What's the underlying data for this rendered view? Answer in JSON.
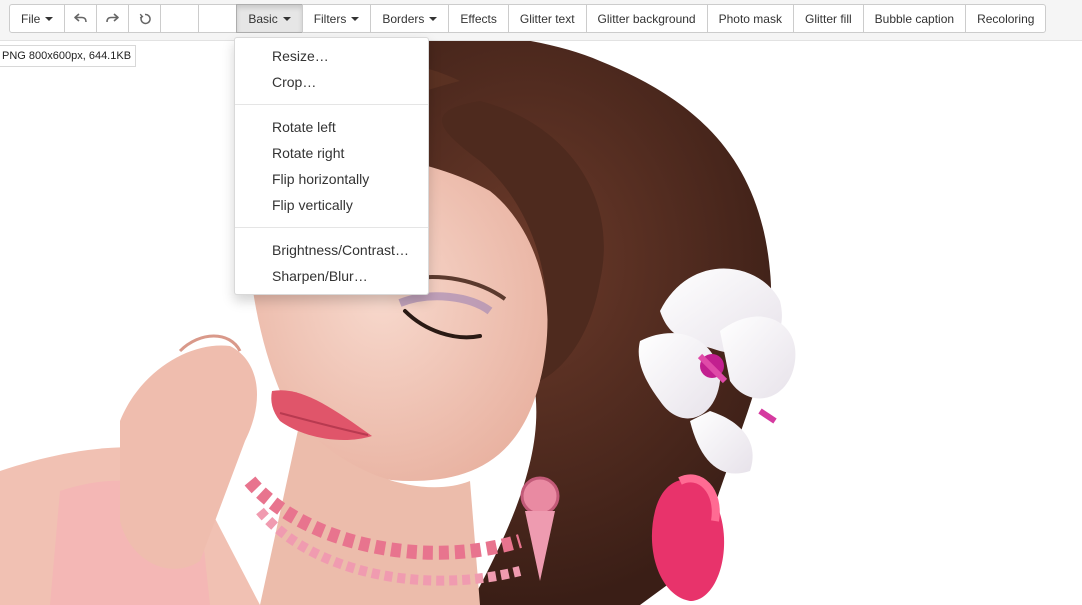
{
  "toolbar": {
    "file_label": "File",
    "undo_icon": "undo-icon",
    "redo_icon": "redo-icon",
    "reset_icon": "reset-icon",
    "basic_label": "Basic",
    "filters_label": "Filters",
    "borders_label": "Borders",
    "effects_label": "Effects",
    "glitter_text_label": "Glitter text",
    "glitter_background_label": "Glitter background",
    "photo_mask_label": "Photo mask",
    "glitter_fill_label": "Glitter fill",
    "bubble_caption_label": "Bubble caption",
    "recoloring_label": "Recoloring"
  },
  "image_info": "PNG 800x600px, 644.1KB",
  "basic_menu": {
    "resize": "Resize…",
    "crop": "Crop…",
    "rotate_left": "Rotate left",
    "rotate_right": "Rotate right",
    "flip_horizontally": "Flip horizontally",
    "flip_vertically": "Flip vertically",
    "brightness_contrast": "Brightness/Contrast…",
    "sharpen_blur": "Sharpen/Blur…"
  },
  "colors": {
    "toolbar_bg": "#f5f5f5",
    "button_border": "#cccccc",
    "active_button_bg": "#e6e6e6",
    "hair": "#4a2a1f",
    "skin": "#f2c7b8",
    "lips": "#e0556a",
    "flower_pink": "#e8336b"
  }
}
